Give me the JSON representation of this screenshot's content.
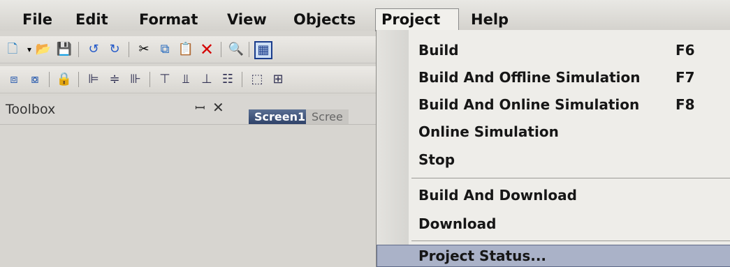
{
  "menubar": {
    "items": [
      "File",
      "Edit",
      "Format",
      "View",
      "Objects",
      "Project",
      "Help"
    ]
  },
  "panel": {
    "toolbox_label": "Toolbox",
    "pin_glyph": "ꟷ",
    "close_glyph": "✕",
    "tabs": [
      "Screen1",
      "Scree"
    ]
  },
  "project_menu": {
    "items": [
      {
        "label": "Build",
        "shortcut": "F6"
      },
      {
        "label": "Build And Offline Simulation",
        "shortcut": "F7"
      },
      {
        "label": "Build And Online Simulation",
        "shortcut": "F8"
      },
      {
        "label": "Online Simulation",
        "shortcut": ""
      },
      {
        "label": "Stop",
        "shortcut": ""
      },
      {
        "label": "Build And Download",
        "shortcut": ""
      },
      {
        "label": "Download",
        "shortcut": ""
      },
      {
        "label": "Project Status...",
        "shortcut": ""
      }
    ],
    "highlighted": "Project Status..."
  },
  "toolbar1_icons": [
    "new-icon",
    "dropdown-arrow-icon",
    "open-folder-icon",
    "save-icon",
    "undo-icon",
    "redo-icon",
    "cut-icon",
    "copy-icon",
    "paste-icon",
    "delete-icon",
    "find-icon",
    "grid-icon"
  ],
  "toolbar2_icons": [
    "group-icon",
    "ungroup-icon",
    "lock-icon",
    "align-left-icon",
    "align-center-icon",
    "align-right-icon",
    "align-top-icon",
    "align-middle-icon",
    "align-bottom-icon",
    "distribute-icon",
    "size-icon",
    "order-icon"
  ]
}
